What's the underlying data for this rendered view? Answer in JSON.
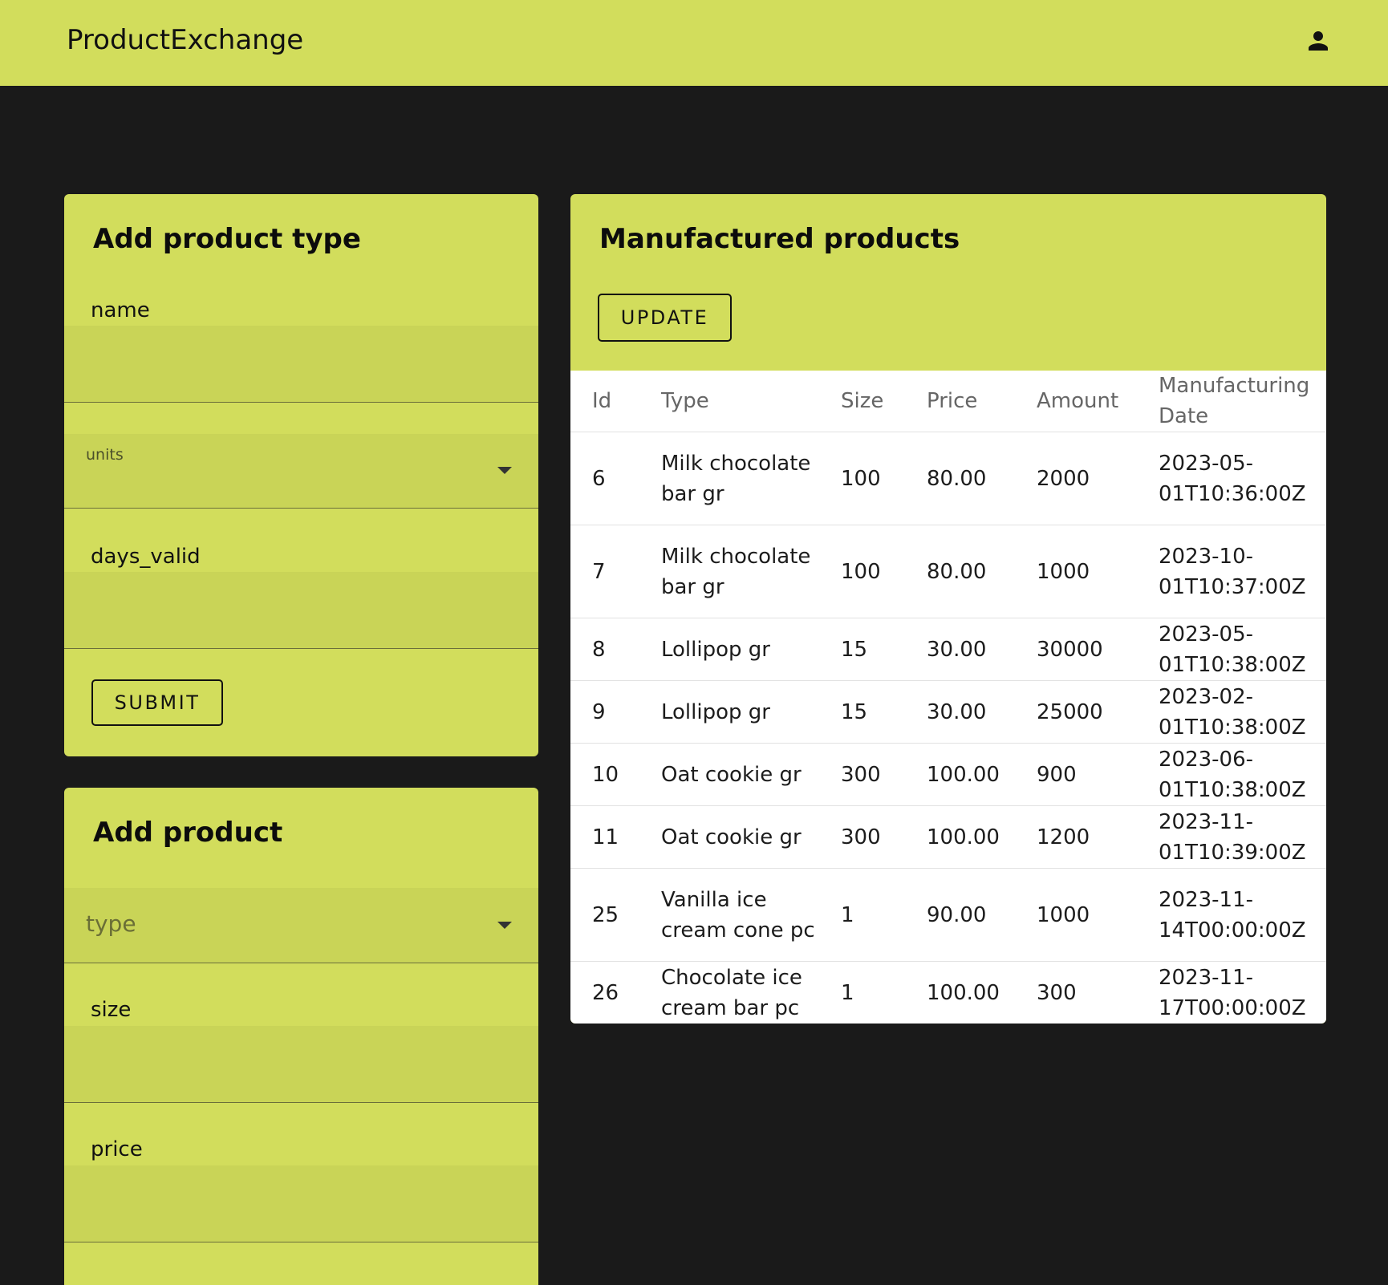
{
  "app": {
    "title": "ProductExchange",
    "user_icon": "account-icon"
  },
  "add_product_type": {
    "title": "Add product type",
    "name_label": "name",
    "units_label": "units",
    "days_valid_label": "days_valid",
    "submit_label": "SUBMIT"
  },
  "add_product": {
    "title": "Add product",
    "type_placeholder": "type",
    "size_label": "size",
    "price_label": "price"
  },
  "manufactured_products": {
    "title": "Manufactured products",
    "update_label": "UPDATE",
    "columns": [
      "Id",
      "Type",
      "Size",
      "Price",
      "Amount",
      "Manufacturing Date"
    ],
    "rows": [
      {
        "id": "6",
        "type": "Milk chocolate bar gr",
        "size": "100",
        "price": "80.00",
        "amount": "2000",
        "date": "2023-05-01T10:36:00Z"
      },
      {
        "id": "7",
        "type": "Milk chocolate bar gr",
        "size": "100",
        "price": "80.00",
        "amount": "1000",
        "date": "2023-10-01T10:37:00Z"
      },
      {
        "id": "8",
        "type": "Lollipop gr",
        "size": "15",
        "price": "30.00",
        "amount": "30000",
        "date": "2023-05-01T10:38:00Z"
      },
      {
        "id": "9",
        "type": "Lollipop gr",
        "size": "15",
        "price": "30.00",
        "amount": "25000",
        "date": "2023-02-01T10:38:00Z"
      },
      {
        "id": "10",
        "type": "Oat cookie gr",
        "size": "300",
        "price": "100.00",
        "amount": "900",
        "date": "2023-06-01T10:38:00Z"
      },
      {
        "id": "11",
        "type": "Oat cookie gr",
        "size": "300",
        "price": "100.00",
        "amount": "1200",
        "date": "2023-11-01T10:39:00Z"
      },
      {
        "id": "25",
        "type": "Vanilla ice cream cone pc",
        "size": "1",
        "price": "90.00",
        "amount": "1000",
        "date": "2023-11-14T00:00:00Z"
      },
      {
        "id": "26",
        "type": "Chocolate ice cream bar pc",
        "size": "1",
        "price": "100.00",
        "amount": "300",
        "date": "2023-11-17T00:00:00Z"
      }
    ]
  },
  "colors": {
    "accent": "#d2dd5c",
    "field_fill": "#c9d457",
    "background": "#1a1a1a"
  }
}
